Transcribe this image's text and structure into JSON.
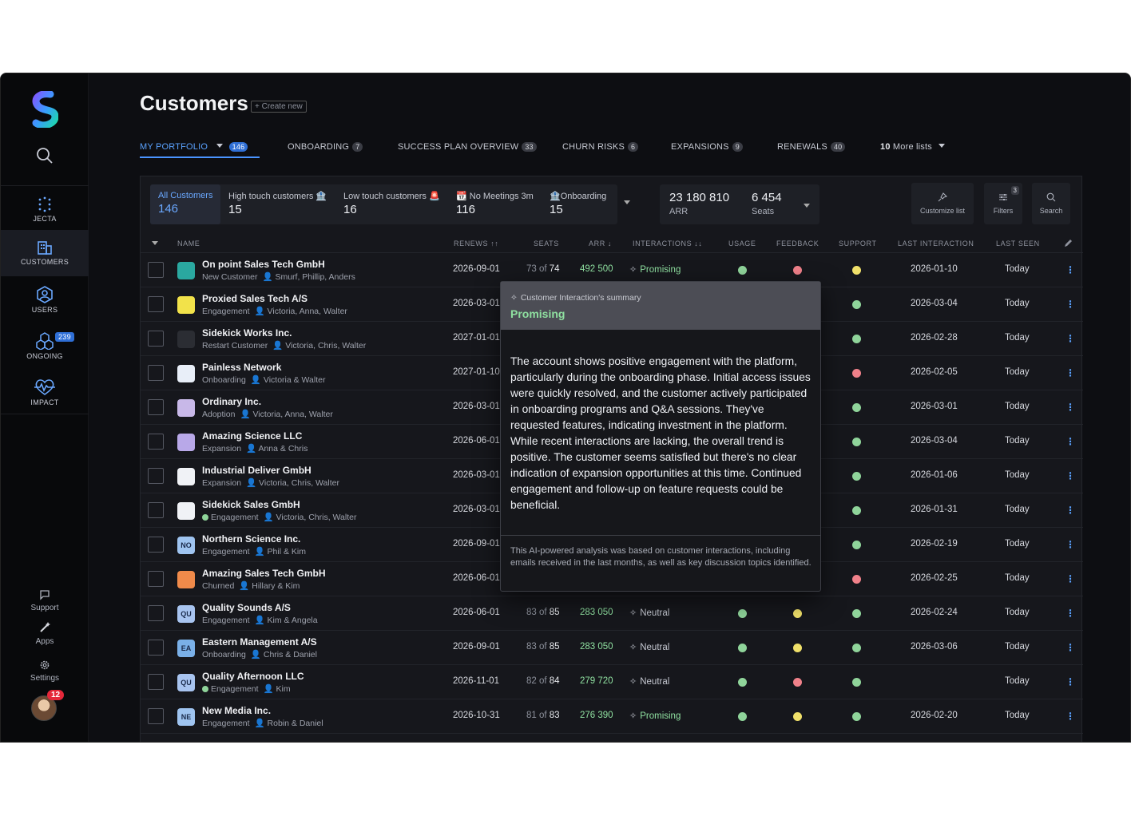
{
  "sidebar": {
    "nav": [
      {
        "label": "JECTA"
      },
      {
        "label": "CUSTOMERS"
      },
      {
        "label": "USERS"
      },
      {
        "label": "ONGOING",
        "badge": "239"
      },
      {
        "label": "IMPACT"
      }
    ],
    "bottom": [
      {
        "label": "Support"
      },
      {
        "label": "Apps"
      },
      {
        "label": "Settings"
      }
    ],
    "avatar_badge": "12"
  },
  "page": {
    "title": "Customers",
    "create_new": "+ Create new"
  },
  "tabs": [
    {
      "label": "MY PORTFOLIO",
      "count": "146",
      "active": true
    },
    {
      "label": "ONBOARDING",
      "count": "7"
    },
    {
      "label": "SUCCESS PLAN OVERVIEW",
      "count": "33"
    },
    {
      "label": "CHURN RISKS",
      "count": "6"
    },
    {
      "label": "EXPANSIONS",
      "count": "9"
    },
    {
      "label": "RENEWALS",
      "count": "40"
    }
  ],
  "more_lists": {
    "count": "10",
    "label": "More lists"
  },
  "segments": [
    {
      "label": "All Customers",
      "value": "146",
      "active": true
    },
    {
      "label": "High touch customers 🏦",
      "value": "15"
    },
    {
      "label": "Low touch customers 🚨",
      "value": "16"
    },
    {
      "label": "📆 No Meetings 3m",
      "value": "116"
    },
    {
      "label": "🏦Onboarding",
      "value": "15"
    }
  ],
  "kpis": [
    {
      "value": "23 180 810",
      "label": "ARR"
    },
    {
      "value": "6 454",
      "label": "Seats"
    }
  ],
  "tools": {
    "customize": "Customize list",
    "filters": "Filters",
    "filters_badge": "3",
    "search": "Search"
  },
  "columns": {
    "name": "NAME",
    "renews": "RENEWS ↑↑",
    "seats": "SEATS",
    "arr": "ARR ↓",
    "interactions": "INTERACTIONS ↓↓",
    "usage": "USAGE",
    "feedback": "FEEDBACK",
    "support": "SUPPORT",
    "last_interaction": "LAST INTERACTION",
    "last_seen": "LAST SEEN"
  },
  "colors": {
    "green": "#8fd49a",
    "yellow": "#f0e06a",
    "red": "#f0818a",
    "accent": "#4a94ff"
  },
  "rows": [
    {
      "logo": "",
      "logo_bg": "#2aa8a0",
      "name": "On point Sales Tech GmbH",
      "stage": "New Customer",
      "owners": "Smurf, Phillip, Anders",
      "stage_dot": false,
      "renews": "2026-09-01",
      "seats_used": "73",
      "seats_total": "74",
      "arr": "492 500",
      "interaction": "Promising",
      "usage": "green",
      "feedback": "red",
      "support": "yellow",
      "last_interaction": "2026-01-10",
      "last_seen": "Today"
    },
    {
      "logo": "",
      "logo_bg": "#f2e24a",
      "name": "Proxied Sales Tech A/S",
      "stage": "Engagement",
      "owners": "Victoria, Anna, Walter",
      "stage_dot": false,
      "renews": "2026-03-01",
      "seats_used": "",
      "seats_total": "",
      "arr": "",
      "interaction": "",
      "usage": "",
      "feedback": "",
      "support": "green",
      "last_interaction": "2026-03-04",
      "last_seen": "Today"
    },
    {
      "logo": "",
      "logo_bg": "#2b2d33",
      "name": "Sidekick Works Inc.",
      "stage": "Restart Customer",
      "owners": "Victoria, Chris, Walter",
      "stage_dot": false,
      "renews": "2027-01-01",
      "seats_used": "",
      "seats_total": "",
      "arr": "",
      "interaction": "",
      "usage": "",
      "feedback": "",
      "support": "green",
      "last_interaction": "2026-02-28",
      "last_seen": "Today"
    },
    {
      "logo": "",
      "logo_bg": "#e8eef8",
      "name": "Painless Network",
      "stage": "Onboarding",
      "owners": "Victoria & Walter",
      "stage_dot": false,
      "renews": "2027-01-10",
      "seats_used": "",
      "seats_total": "",
      "arr": "",
      "interaction": "",
      "usage": "",
      "feedback": "",
      "support": "red",
      "last_interaction": "2026-02-05",
      "last_seen": "Today"
    },
    {
      "logo": "",
      "logo_bg": "#c8b8e8",
      "name": "Ordinary Inc.",
      "stage": "Adoption",
      "owners": "Victoria, Anna, Walter",
      "stage_dot": false,
      "renews": "2026-03-01",
      "seats_used": "",
      "seats_total": "",
      "arr": "",
      "interaction": "",
      "usage": "",
      "feedback": "",
      "support": "green",
      "last_interaction": "2026-03-01",
      "last_seen": "Today"
    },
    {
      "logo": "",
      "logo_bg": "#b8a8e8",
      "name": "Amazing Science LLC",
      "stage": "Expansion",
      "owners": "Anna & Chris",
      "stage_dot": false,
      "renews": "2026-06-01",
      "seats_used": "",
      "seats_total": "",
      "arr": "",
      "interaction": "",
      "usage": "",
      "feedback": "",
      "support": "green",
      "last_interaction": "2026-03-04",
      "last_seen": "Today"
    },
    {
      "logo": "",
      "logo_bg": "#f0f2f6",
      "name": "Industrial Deliver GmbH",
      "stage": "Expansion",
      "owners": "Victoria, Chris, Walter",
      "stage_dot": false,
      "renews": "2026-03-01",
      "seats_used": "",
      "seats_total": "",
      "arr": "",
      "interaction": "",
      "usage": "",
      "feedback": "",
      "support": "green",
      "last_interaction": "2026-01-06",
      "last_seen": "Today"
    },
    {
      "logo": "",
      "logo_bg": "#f0f2f6",
      "name": "Sidekick Sales GmbH",
      "stage": "Engagement",
      "owners": "Victoria, Chris, Walter",
      "stage_dot": true,
      "renews": "2026-03-01",
      "seats_used": "",
      "seats_total": "",
      "arr": "",
      "interaction": "",
      "usage": "",
      "feedback": "",
      "support": "green",
      "last_interaction": "2026-01-31",
      "last_seen": "Today"
    },
    {
      "logo": "NO",
      "logo_bg": "#9fc4f0",
      "name": "Northern Science Inc.",
      "stage": "Engagement",
      "owners": "Phil & Kim",
      "stage_dot": false,
      "renews": "2026-09-01",
      "seats_used": "",
      "seats_total": "",
      "arr": "",
      "interaction": "",
      "usage": "",
      "feedback": "",
      "support": "green",
      "last_interaction": "2026-02-19",
      "last_seen": "Today"
    },
    {
      "logo": "",
      "logo_bg": "#f08a4a",
      "name": "Amazing Sales Tech GmbH",
      "stage": "Churned",
      "owners": "Hillary & Kim",
      "stage_dot": false,
      "renews": "2026-06-01",
      "seats_used": "",
      "seats_total": "",
      "arr": "",
      "interaction": "",
      "usage": "",
      "feedback": "",
      "support": "red",
      "last_interaction": "2026-02-25",
      "last_seen": "Today"
    },
    {
      "logo": "QU",
      "logo_bg": "#a8c4f0",
      "name": "Quality Sounds A/S",
      "stage": "Engagement",
      "owners": "Kim & Angela",
      "stage_dot": false,
      "renews": "2026-06-01",
      "seats_used": "83",
      "seats_total": "85",
      "arr": "283 050",
      "interaction": "Neutral",
      "usage": "green",
      "feedback": "yellow",
      "support": "green",
      "last_interaction": "2026-02-24",
      "last_seen": "Today"
    },
    {
      "logo": "EA",
      "logo_bg": "#7ab0e8",
      "name": "Eastern Management A/S",
      "stage": "Onboarding",
      "owners": "Chris & Daniel",
      "stage_dot": false,
      "renews": "2026-09-01",
      "seats_used": "83",
      "seats_total": "85",
      "arr": "283 050",
      "interaction": "Neutral",
      "usage": "green",
      "feedback": "yellow",
      "support": "green",
      "last_interaction": "2026-03-06",
      "last_seen": "Today"
    },
    {
      "logo": "QU",
      "logo_bg": "#a8c4f0",
      "name": "Quality Afternoon LLC",
      "stage": "Engagement",
      "owners": "Kim",
      "stage_dot": true,
      "renews": "2026-11-01",
      "seats_used": "82",
      "seats_total": "84",
      "arr": "279 720",
      "interaction": "Neutral",
      "usage": "green",
      "feedback": "red",
      "support": "green",
      "last_interaction": "",
      "last_seen": "Today"
    },
    {
      "logo": "NE",
      "logo_bg": "#9fc4f0",
      "name": "New Media Inc.",
      "stage": "Engagement",
      "owners": "Robin & Daniel",
      "stage_dot": false,
      "renews": "2026-10-31",
      "seats_used": "81",
      "seats_total": "83",
      "arr": "276 390",
      "interaction": "Promising",
      "usage": "green",
      "feedback": "yellow",
      "support": "green",
      "last_interaction": "2026-02-20",
      "last_seen": "Today"
    }
  ],
  "popover": {
    "label": "Customer Interaction's summary",
    "value": "Promising",
    "body": "The account shows positive engagement with the platform, particularly during the onboarding phase. Initial access issues were quickly resolved, and the customer actively participated in onboarding programs and Q&A sessions. They've requested features, indicating investment in the platform. While recent interactions are lacking, the overall trend is positive. The customer seems satisfied but there's no clear indication of expansion opportunities at this time. Continued engagement and follow-up on feature requests could be beneficial.",
    "footer": "This AI-powered analysis was based on customer interactions, including emails received in the last months, as well as key discussion topics identified."
  }
}
